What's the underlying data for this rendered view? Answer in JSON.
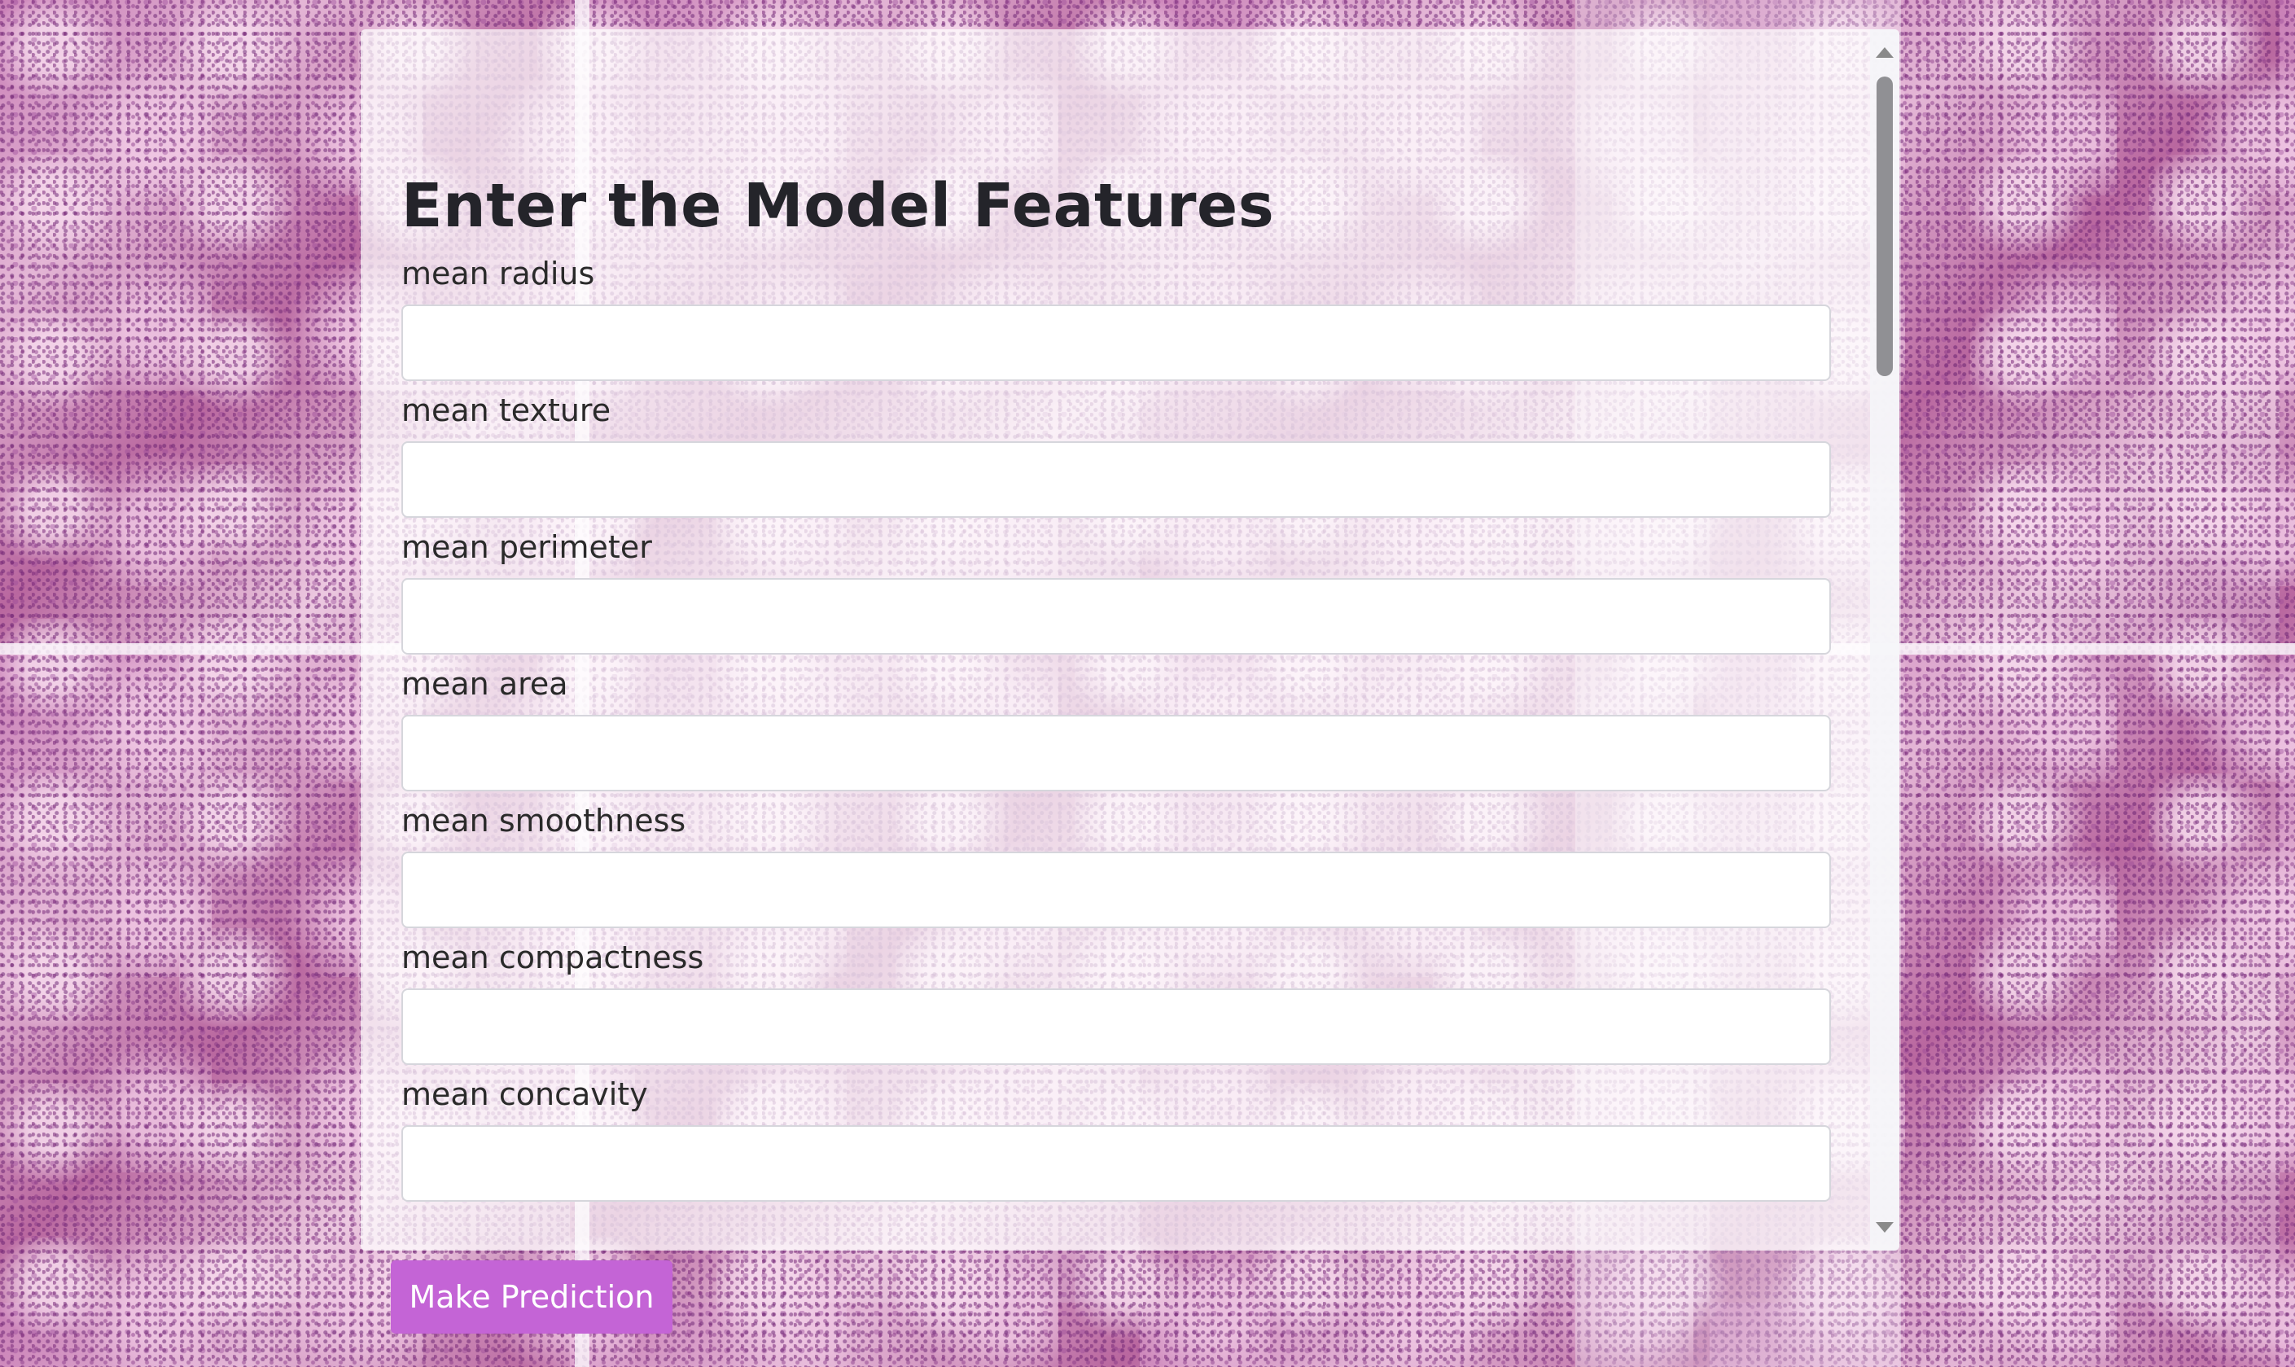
{
  "form": {
    "title": "Enter the Model Features",
    "fields": [
      {
        "label": "mean radius",
        "value": ""
      },
      {
        "label": "mean texture",
        "value": ""
      },
      {
        "label": "mean perimeter",
        "value": ""
      },
      {
        "label": "mean area",
        "value": ""
      },
      {
        "label": "mean smoothness",
        "value": ""
      },
      {
        "label": "mean compactness",
        "value": ""
      },
      {
        "label": "mean concavity",
        "value": ""
      }
    ]
  },
  "actions": {
    "predict_label": "Make Prediction"
  },
  "colors": {
    "button": "#c464d6",
    "title": "#24242a"
  }
}
